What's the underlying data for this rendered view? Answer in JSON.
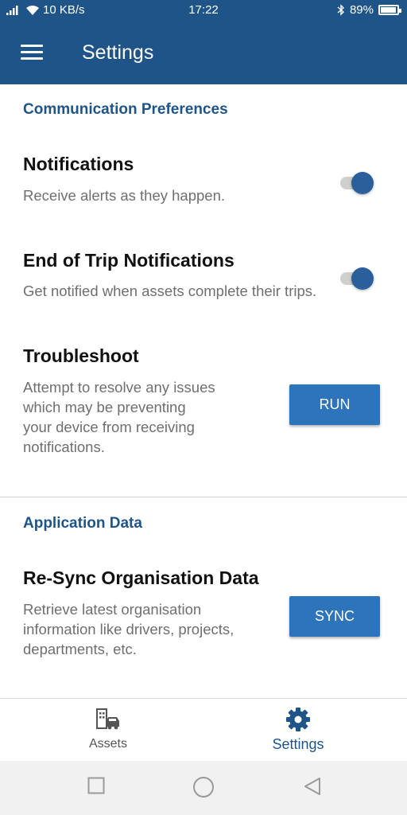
{
  "status_bar": {
    "network_speed": "10 KB/s",
    "time": "17:22",
    "battery": "89%"
  },
  "app_bar": {
    "title": "Settings"
  },
  "communication": {
    "section_title": "Communication Preferences",
    "notifications": {
      "title": "Notifications",
      "description": "Receive alerts as they happen.",
      "enabled": true
    },
    "end_of_trip": {
      "title": "End of Trip Notifications",
      "description": "Get notified when assets complete their trips.",
      "enabled": true
    },
    "troubleshoot": {
      "title": "Troubleshoot",
      "description_lines": [
        "Attempt to resolve any issues",
        "which may be preventing",
        "your device from receiving",
        "notifications."
      ],
      "button_label": "RUN"
    }
  },
  "application_data": {
    "section_title": "Application Data",
    "resync": {
      "title": "Re-Sync Organisation Data",
      "description_lines": [
        "Retrieve latest organisation",
        "information like drivers, projects,",
        "departments, etc."
      ],
      "button_label": "SYNC"
    }
  },
  "bottom_nav": {
    "items": [
      {
        "label": "Assets",
        "icon": "building-car-icon",
        "active": false
      },
      {
        "label": "Settings",
        "icon": "gear-icon",
        "active": true
      }
    ]
  },
  "colors": {
    "primary": "#1f5488",
    "button": "#2d74bb",
    "toggle_thumb": "#2a5f9c",
    "inactive_nav": "#555555"
  }
}
